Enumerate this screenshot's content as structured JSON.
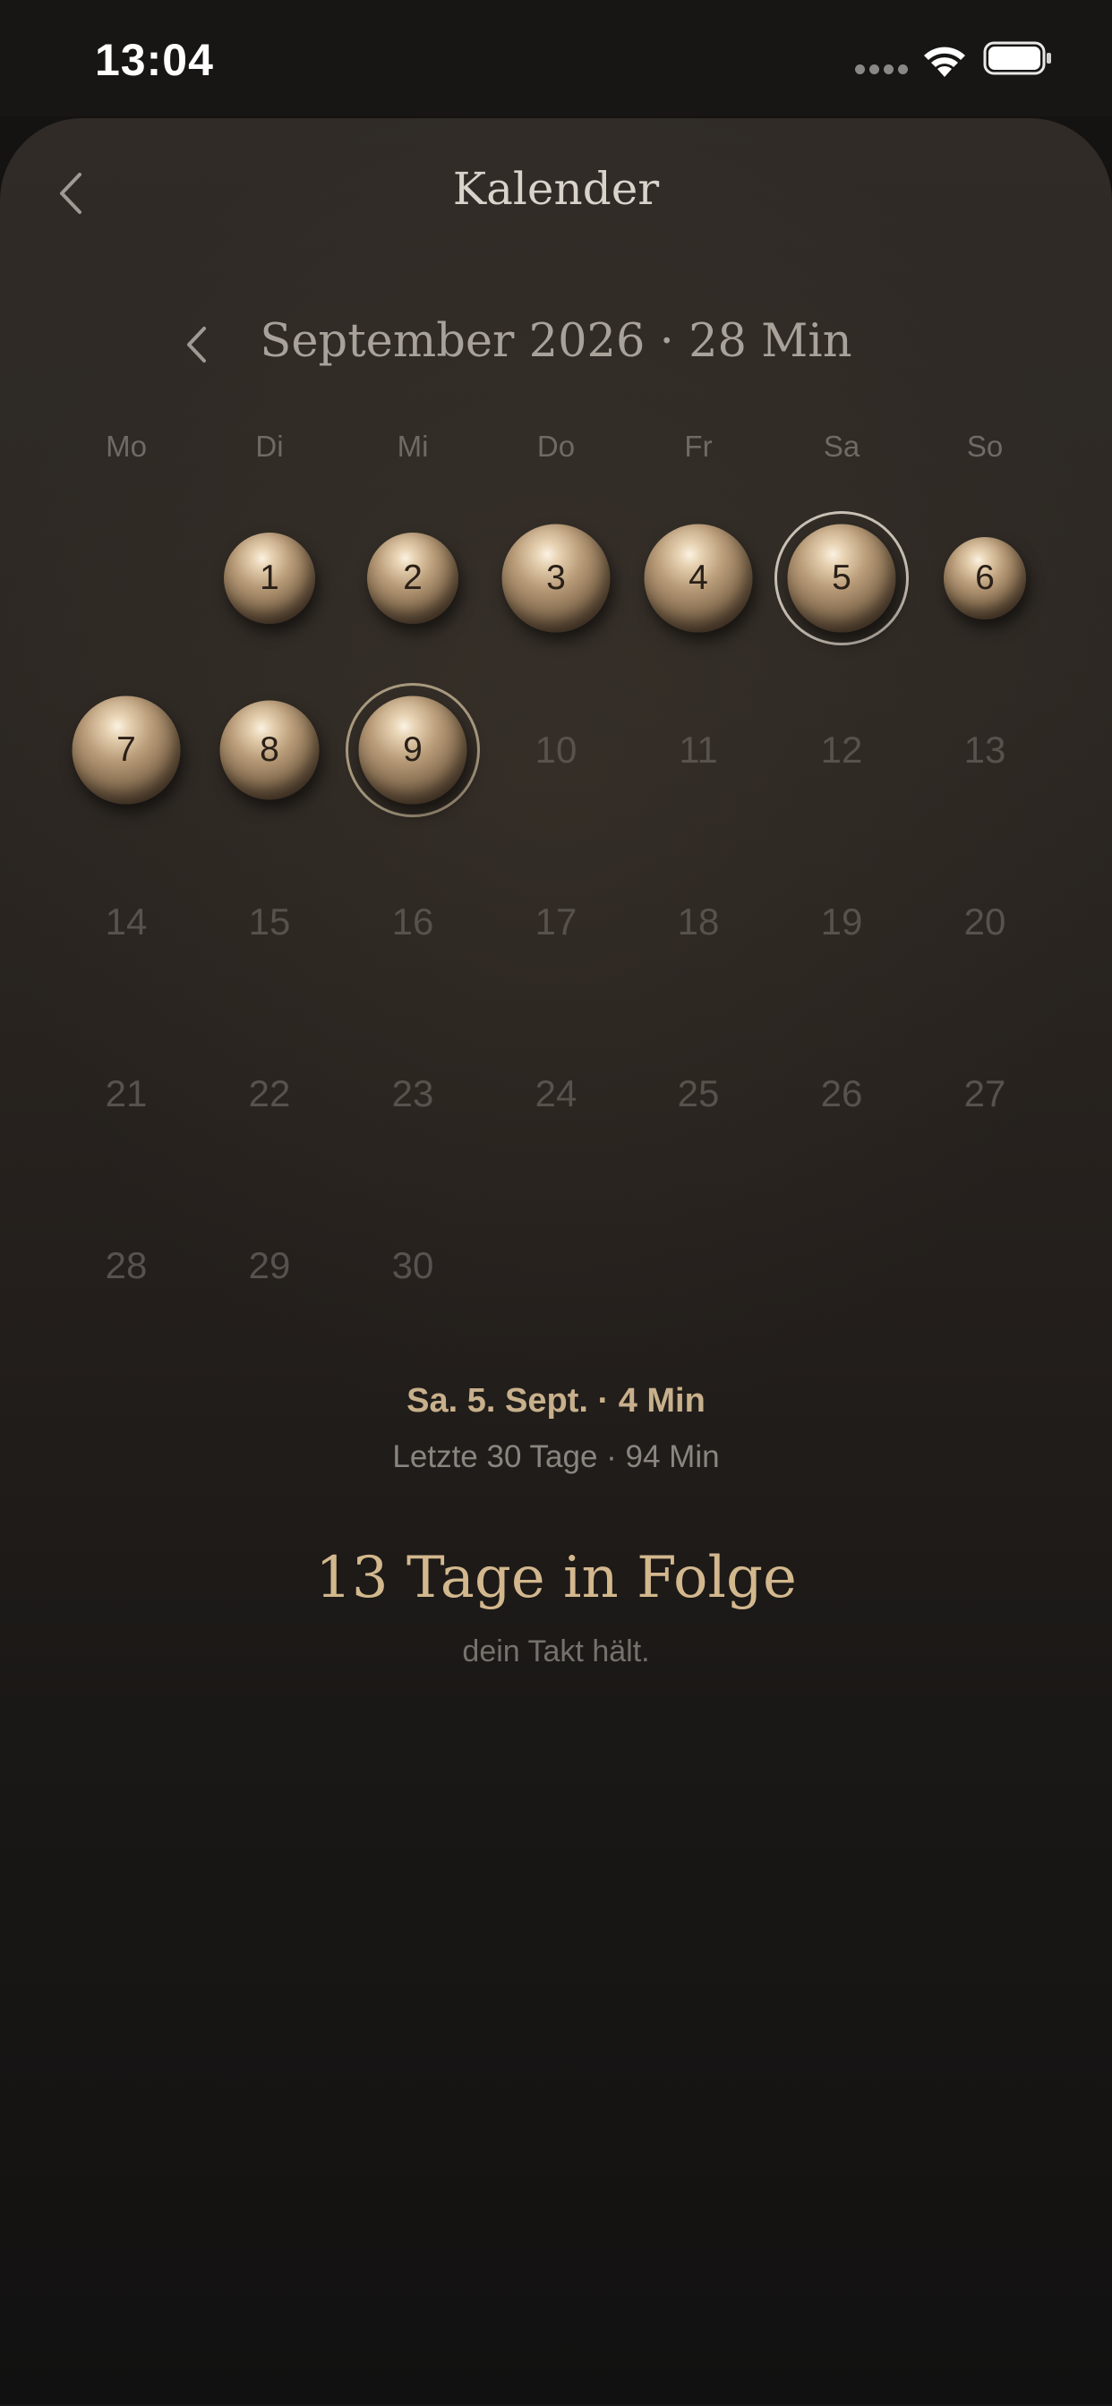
{
  "status_bar": {
    "time": "13:04",
    "icons": [
      "signal-dots-icon",
      "wifi-icon",
      "battery-icon"
    ]
  },
  "header": {
    "back_icon": "chevron-left-icon",
    "title": "Kalender"
  },
  "month": {
    "prev_icon": "chevron-left-icon",
    "title": "September 2026 · 28 Min"
  },
  "weekdays": [
    "Mo",
    "Di",
    "Mi",
    "Do",
    "Fr",
    "Sa",
    "So"
  ],
  "calendar": {
    "days": [
      {
        "label": "1",
        "has_session": true,
        "orb_level": 0.72,
        "selected": false
      },
      {
        "label": "2",
        "has_session": true,
        "orb_level": 0.72,
        "selected": false
      },
      {
        "label": "3",
        "has_session": true,
        "orb_level": 0.85,
        "selected": false
      },
      {
        "label": "4",
        "has_session": true,
        "orb_level": 0.85,
        "selected": false
      },
      {
        "label": "5",
        "has_session": true,
        "orb_level": 0.85,
        "selected": true
      },
      {
        "label": "6",
        "has_session": true,
        "orb_level": 0.65,
        "selected": false
      },
      {
        "label": "7",
        "has_session": true,
        "orb_level": 0.85,
        "selected": false
      },
      {
        "label": "8",
        "has_session": true,
        "orb_level": 0.78,
        "selected": false
      },
      {
        "label": "9",
        "has_session": true,
        "orb_level": 0.85,
        "selected": false,
        "outlined": true
      },
      {
        "label": "10",
        "has_session": false
      },
      {
        "label": "11",
        "has_session": false
      },
      {
        "label": "12",
        "has_session": false
      },
      {
        "label": "13",
        "has_session": false
      },
      {
        "label": "14",
        "has_session": false
      },
      {
        "label": "15",
        "has_session": false
      },
      {
        "label": "16",
        "has_session": false
      },
      {
        "label": "17",
        "has_session": false
      },
      {
        "label": "18",
        "has_session": false
      },
      {
        "label": "19",
        "has_session": false
      },
      {
        "label": "20",
        "has_session": false
      },
      {
        "label": "21",
        "has_session": false
      },
      {
        "label": "22",
        "has_session": false
      },
      {
        "label": "23",
        "has_session": false
      },
      {
        "label": "24",
        "has_session": false
      },
      {
        "label": "25",
        "has_session": false
      },
      {
        "label": "26",
        "has_session": false
      },
      {
        "label": "27",
        "has_session": false
      },
      {
        "label": "28",
        "has_session": false
      },
      {
        "label": "29",
        "has_session": false
      },
      {
        "label": "30",
        "has_session": false
      }
    ]
  },
  "summary": {
    "selected_day": "Sa. 5. Sept. · 4 Min",
    "last_30": "Letzte 30 Tage · 94 Min",
    "streak_title": "13 Tage in Folge",
    "streak_sub": "dein Takt hält."
  },
  "colors": {
    "background": "#141312",
    "accent_gold": "#c8b08c",
    "streak_gold": "#d3b88e",
    "muted_day": "#57524d"
  }
}
